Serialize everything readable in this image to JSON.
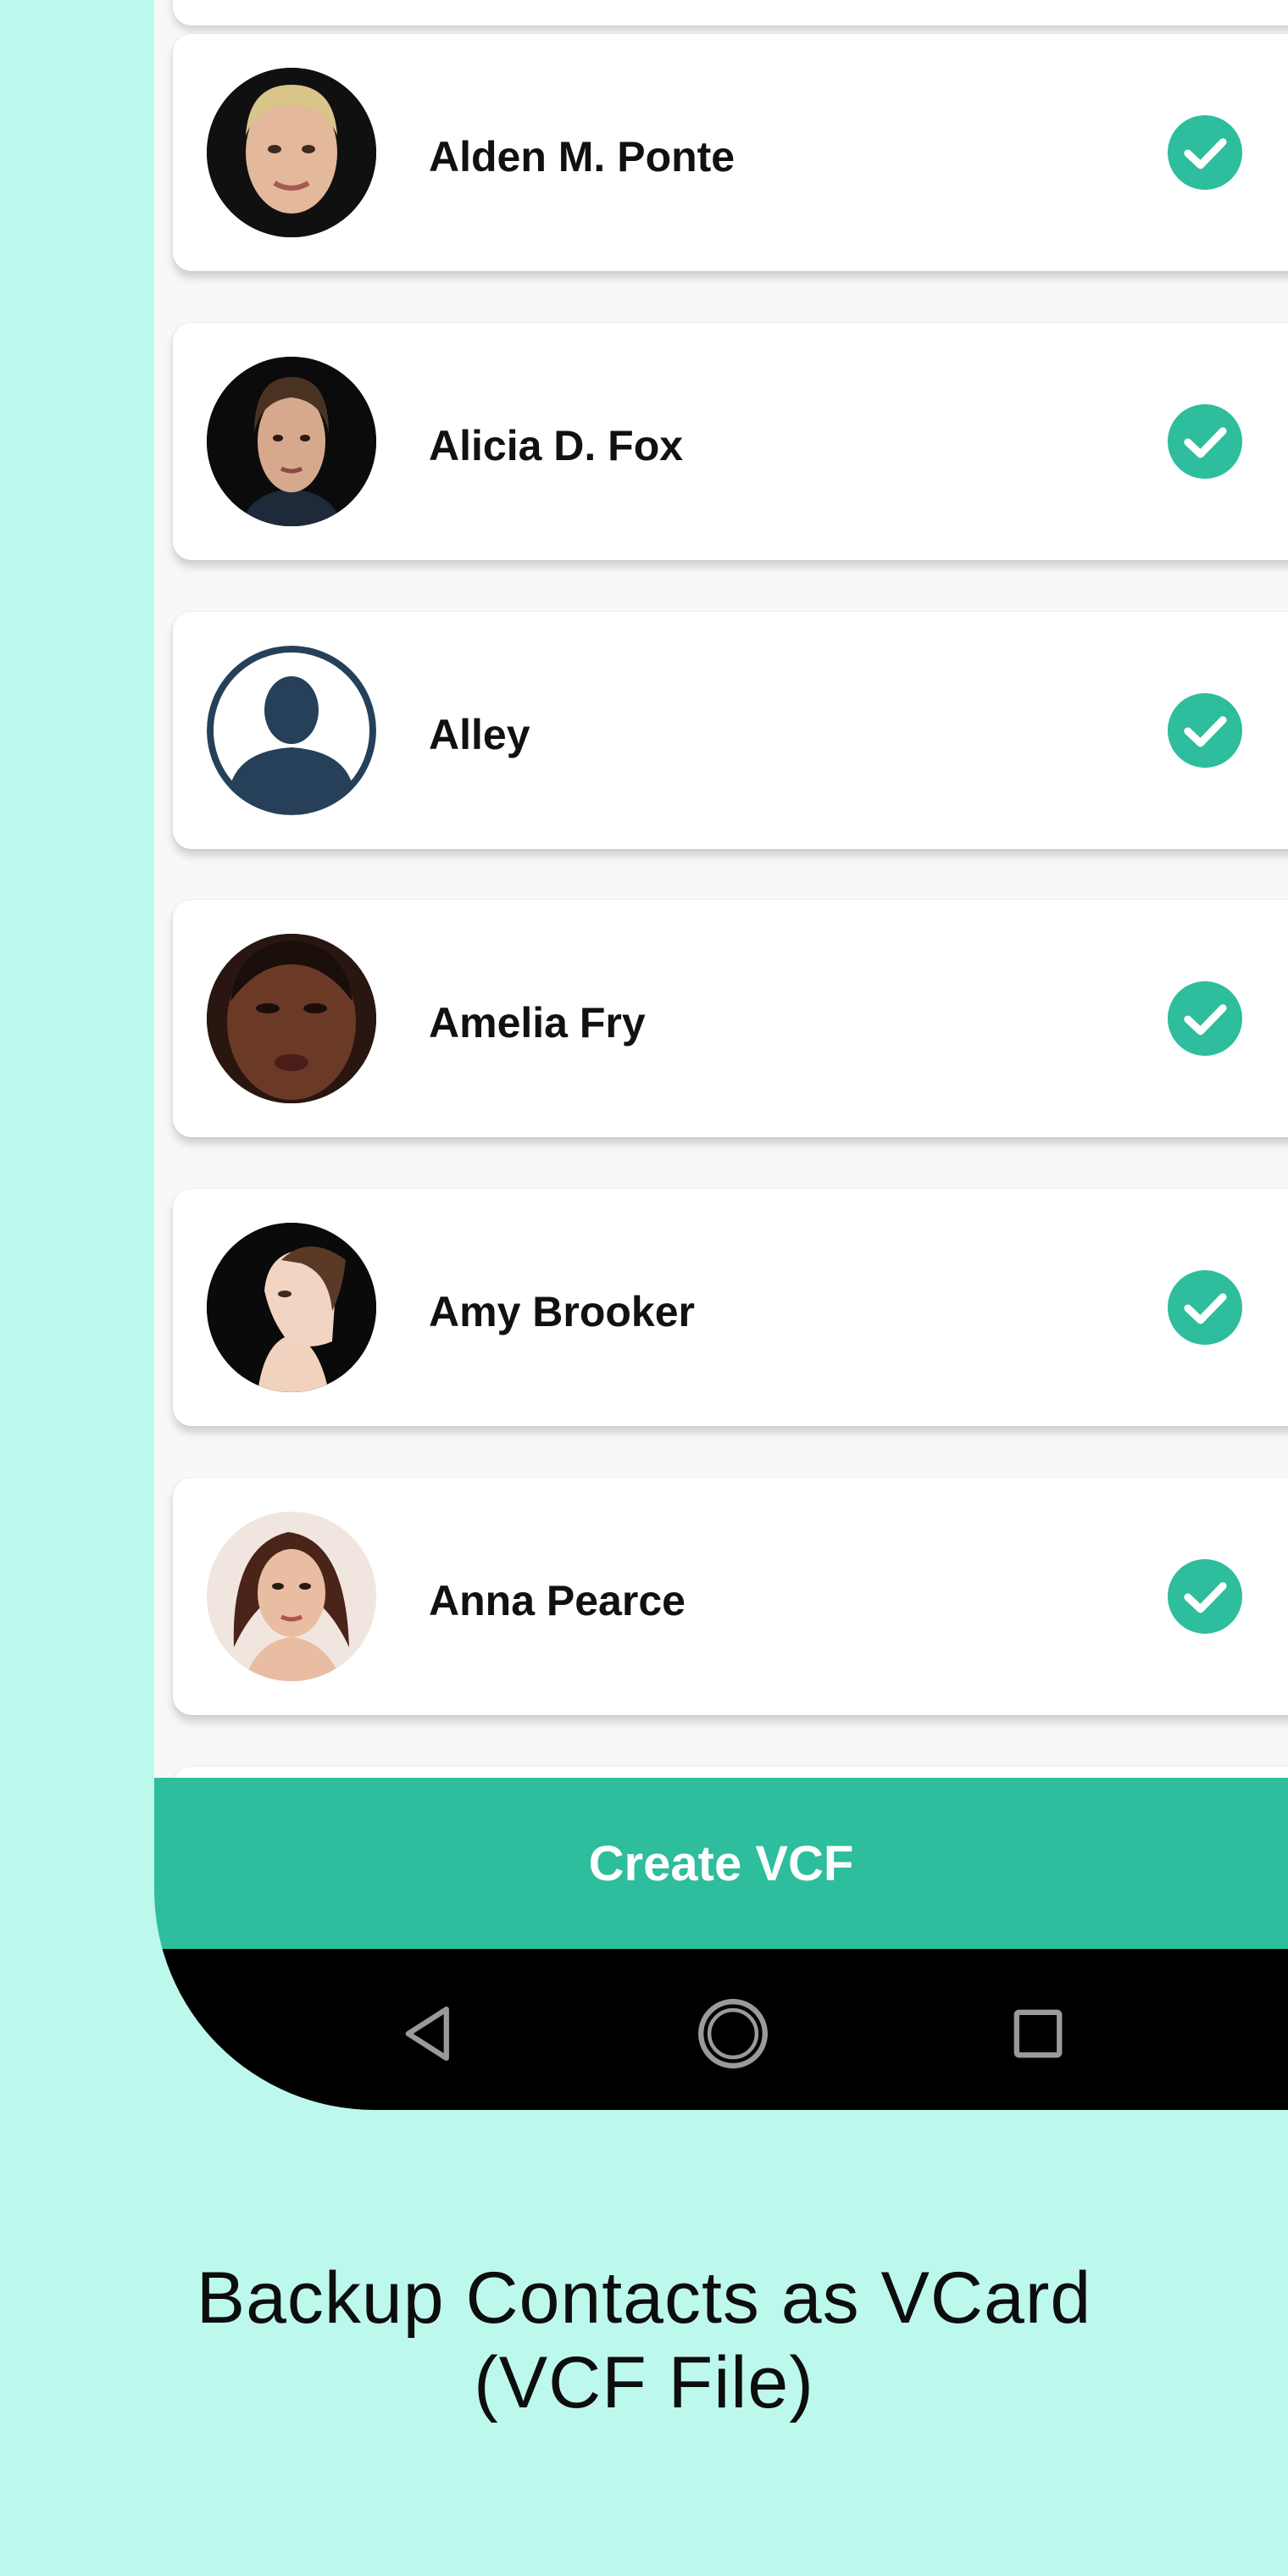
{
  "contacts": [
    {
      "name": "Alden M. Ponte",
      "avatar": "photo-man-blond",
      "selected": true
    },
    {
      "name": "Alicia D. Fox",
      "avatar": "photo-man-dark-hair",
      "selected": true
    },
    {
      "name": "Alley",
      "avatar": "default-person-silhouette",
      "selected": true
    },
    {
      "name": "Amelia Fry",
      "avatar": "photo-woman-dark-skin",
      "selected": true
    },
    {
      "name": "Amy Brooker",
      "avatar": "photo-woman-profile",
      "selected": true
    },
    {
      "name": "Anna Pearce",
      "avatar": "photo-woman-brunette",
      "selected": true
    }
  ],
  "actions": {
    "create_label": "Create VCF"
  },
  "navigation": {
    "icons": [
      "back-triangle-icon",
      "home-circle-icon",
      "recents-square-icon"
    ]
  },
  "caption": {
    "line1": "Backup Contacts as VCard",
    "line2": "(VCF File)"
  },
  "colors": {
    "background": "#bdf8ec",
    "accent": "#2ebd9d",
    "check": "#2ebd9d",
    "nav_bar": "#000000",
    "card": "#ffffff"
  }
}
